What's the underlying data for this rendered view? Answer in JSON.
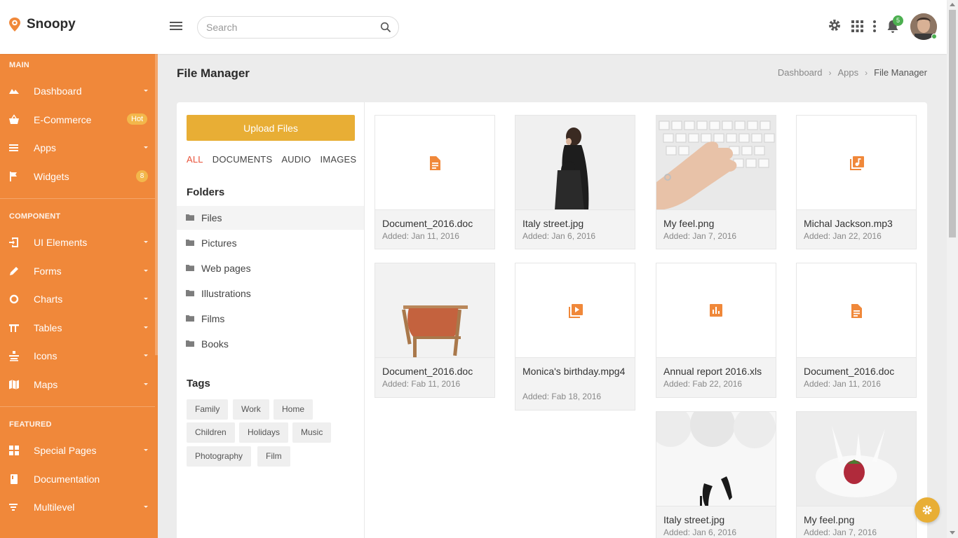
{
  "brand": {
    "name": "Snoopy"
  },
  "search": {
    "placeholder": "Search"
  },
  "header": {
    "notification_count": "5"
  },
  "sidebar": {
    "sections": [
      {
        "title": "MAIN"
      },
      {
        "title": "COMPONENT"
      },
      {
        "title": "FEATURED"
      }
    ],
    "items": [
      {
        "label": "Dashboard",
        "icon": "cloud-icon"
      },
      {
        "label": "E-Commerce",
        "icon": "basket-icon",
        "badge": "Hot"
      },
      {
        "label": "Apps",
        "icon": "list-icon"
      },
      {
        "label": "Widgets",
        "icon": "flag-icon",
        "badge": "8"
      },
      {
        "label": "UI Elements",
        "icon": "login-icon"
      },
      {
        "label": "Forms",
        "icon": "pencil-icon"
      },
      {
        "label": "Charts",
        "icon": "donut-icon"
      },
      {
        "label": "Tables",
        "icon": "table-icon"
      },
      {
        "label": "Icons",
        "icon": "icons-icon"
      },
      {
        "label": "Maps",
        "icon": "map-icon"
      },
      {
        "label": "Special Pages",
        "icon": "pages-icon"
      },
      {
        "label": "Documentation",
        "icon": "book-icon"
      },
      {
        "label": "Multilevel",
        "icon": "filter-icon"
      }
    ]
  },
  "page": {
    "title": "File Manager",
    "breadcrumb": [
      "Dashboard",
      "Apps",
      "File Manager"
    ]
  },
  "file_manager": {
    "upload_label": "Upload Files",
    "filters": [
      "ALL",
      "DOCUMENTS",
      "AUDIO",
      "IMAGES"
    ],
    "folders_title": "Folders",
    "folders": [
      "Files",
      "Pictures",
      "Web pages",
      "Illustrations",
      "Films",
      "Books"
    ],
    "tags_title": "Tags",
    "tags": [
      "Family",
      "Work",
      "Home",
      "Children",
      "Holidays",
      "Music",
      "Photography",
      "Film"
    ],
    "files": [
      {
        "name": "Document_2016.doc",
        "date": "Added: Jan 11, 2016",
        "icon": "document-icon"
      },
      {
        "name": "Italy street.jpg",
        "date": "Added: Jan 6, 2016",
        "icon": "image-woman-bag"
      },
      {
        "name": "My feel.png",
        "date": "Added: Jan 7, 2016",
        "icon": "image-keyboard-hand"
      },
      {
        "name": "Michal Jackson.mp3",
        "date": "Added: Jan 22, 2016",
        "icon": "audio-library-icon"
      },
      {
        "name": "Document_2016.doc",
        "date": "Added: Fab 11, 2016",
        "icon": "image-chair"
      },
      {
        "name": "Monica's birthday.mpg4",
        "date": "Added: Fab 18, 2016",
        "icon": "video-library-icon"
      },
      {
        "name": "Annual report 2016.xls",
        "date": "Added: Fab 22, 2016",
        "icon": "chart-icon"
      },
      {
        "name": "Document_2016.doc",
        "date": "Added: Jan 11, 2016",
        "icon": "document-icon"
      },
      {
        "name": "Italy street.jpg",
        "date": "Added: Jan 6, 2016",
        "icon": "image-heels-balloons"
      },
      {
        "name": "My feel.png",
        "date": "Added: Jan 7, 2016",
        "icon": "image-strawberry-milk"
      }
    ]
  },
  "colors": {
    "sidebar": "#f0883a",
    "accent": "#e8ae35",
    "file_icon": "#f0883a",
    "active_filter": "#e8533a"
  }
}
